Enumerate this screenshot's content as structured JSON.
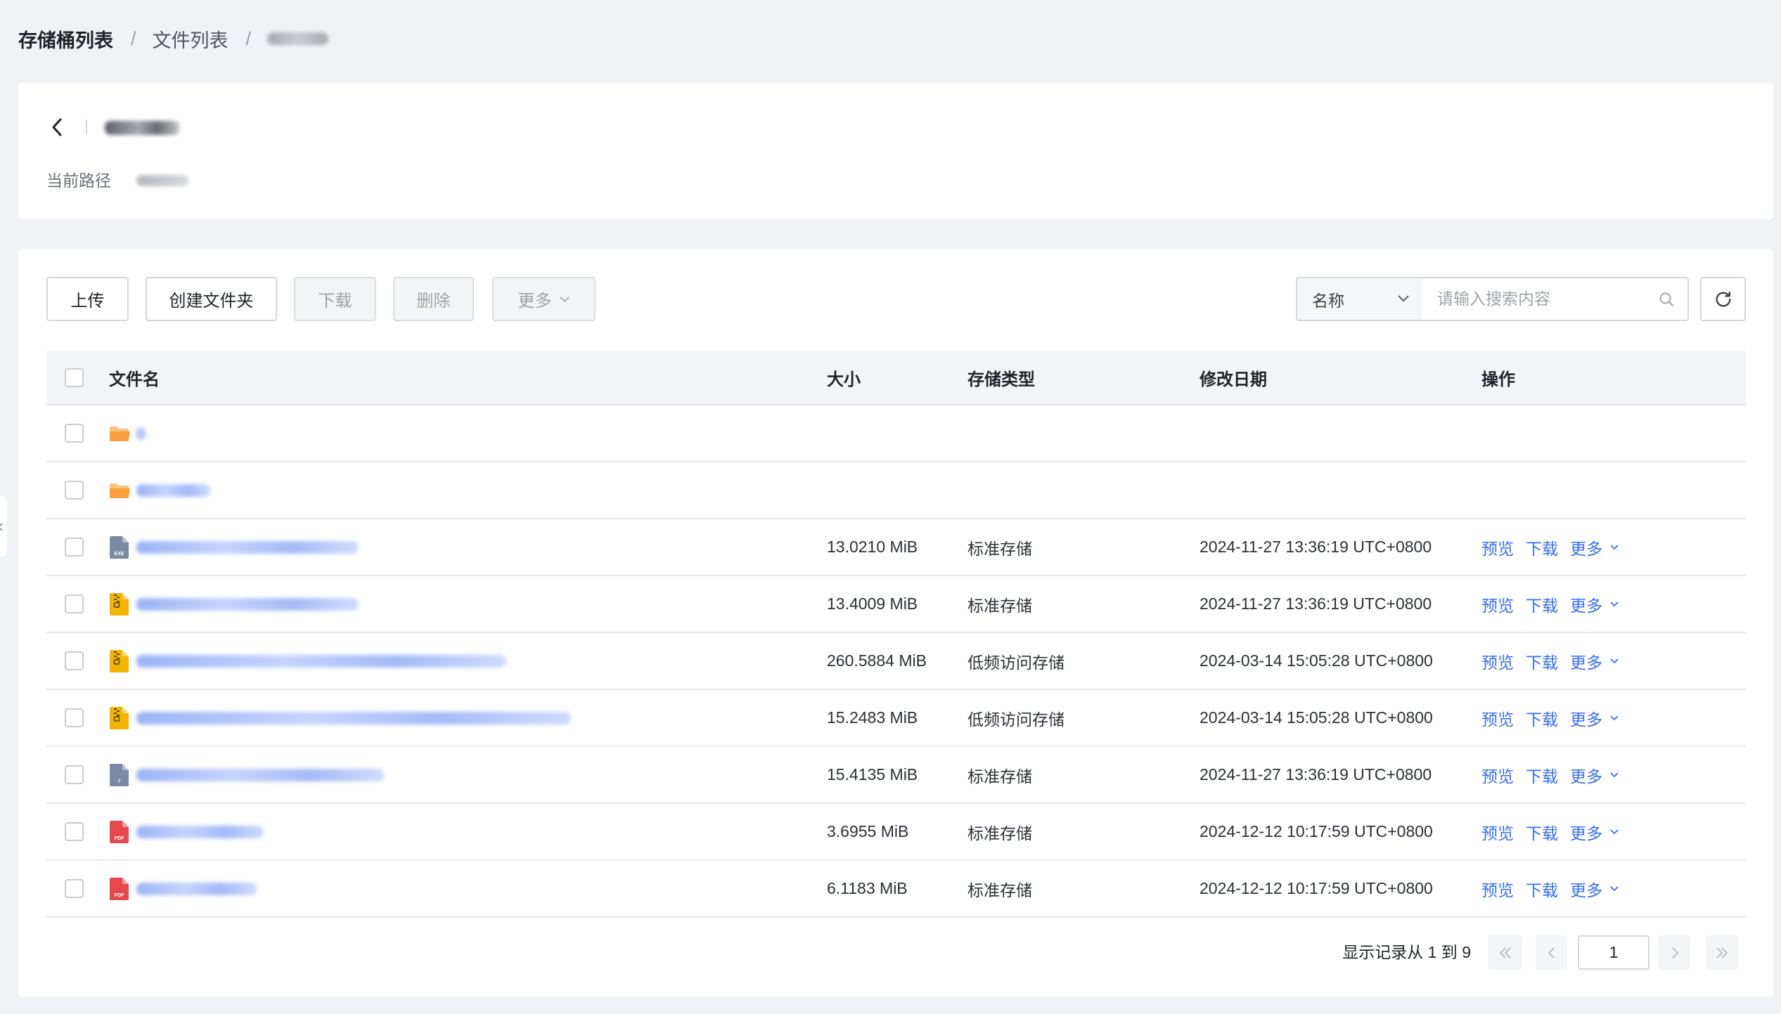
{
  "breadcrumb": {
    "root": "存储桶列表",
    "files": "文件列表",
    "separator": "/"
  },
  "header": {
    "path_label": "当前路径"
  },
  "toolbar": {
    "upload": "上传",
    "create_folder": "创建文件夹",
    "download": "下载",
    "delete": "删除",
    "more": "更多"
  },
  "search": {
    "field": "名称",
    "placeholder": "请输入搜索内容"
  },
  "table": {
    "columns": {
      "name": "文件名",
      "size": "大小",
      "storage_class": "存储类型",
      "modified": "修改日期",
      "actions": "操作"
    },
    "rows": [
      {
        "icon": "folder-icon"
      },
      {
        "icon": "folder-icon"
      },
      {
        "icon": "exe-file-icon",
        "size": "13.0210 MiB",
        "storage_class": "标准存储",
        "modified": "2024-11-27 13:36:19 UTC+0800"
      },
      {
        "icon": "zip-file-icon",
        "size": "13.4009 MiB",
        "storage_class": "标准存储",
        "modified": "2024-11-27 13:36:19 UTC+0800"
      },
      {
        "icon": "zip-file-icon",
        "size": "260.5884 MiB",
        "storage_class": "低频访问存储",
        "modified": "2024-03-14 15:05:28 UTC+0800"
      },
      {
        "icon": "zip-file-icon",
        "size": "15.2483 MiB",
        "storage_class": "低频访问存储",
        "modified": "2024-03-14 15:05:28 UTC+0800"
      },
      {
        "icon": "unknown-file-icon",
        "size": "15.4135 MiB",
        "storage_class": "标准存储",
        "modified": "2024-11-27 13:36:19 UTC+0800"
      },
      {
        "icon": "pdf-file-icon",
        "size": "3.6955 MiB",
        "storage_class": "标准存储",
        "modified": "2024-12-12 10:17:59 UTC+0800"
      },
      {
        "icon": "pdf-file-icon",
        "size": "6.1183 MiB",
        "storage_class": "标准存储",
        "modified": "2024-12-12 10:17:59 UTC+0800"
      }
    ]
  },
  "icon_labels": {
    "exe-file-icon": "EXE",
    "unknown-file-icon": "?",
    "pdf-file-icon": "PDF"
  },
  "row_actions": {
    "preview": "预览",
    "download": "下载",
    "more": "更多"
  },
  "pagination": {
    "summary": "显示记录从 1 到 9",
    "current_page": "1"
  },
  "colors": {
    "link": "#366ef4",
    "folder": "#f9a03c",
    "folder_back": "#fbc27c",
    "zip": "#f5b400",
    "pdf": "#e5484d",
    "generic_file": "#7c8aa5",
    "page_background": "#f1f2f5"
  }
}
